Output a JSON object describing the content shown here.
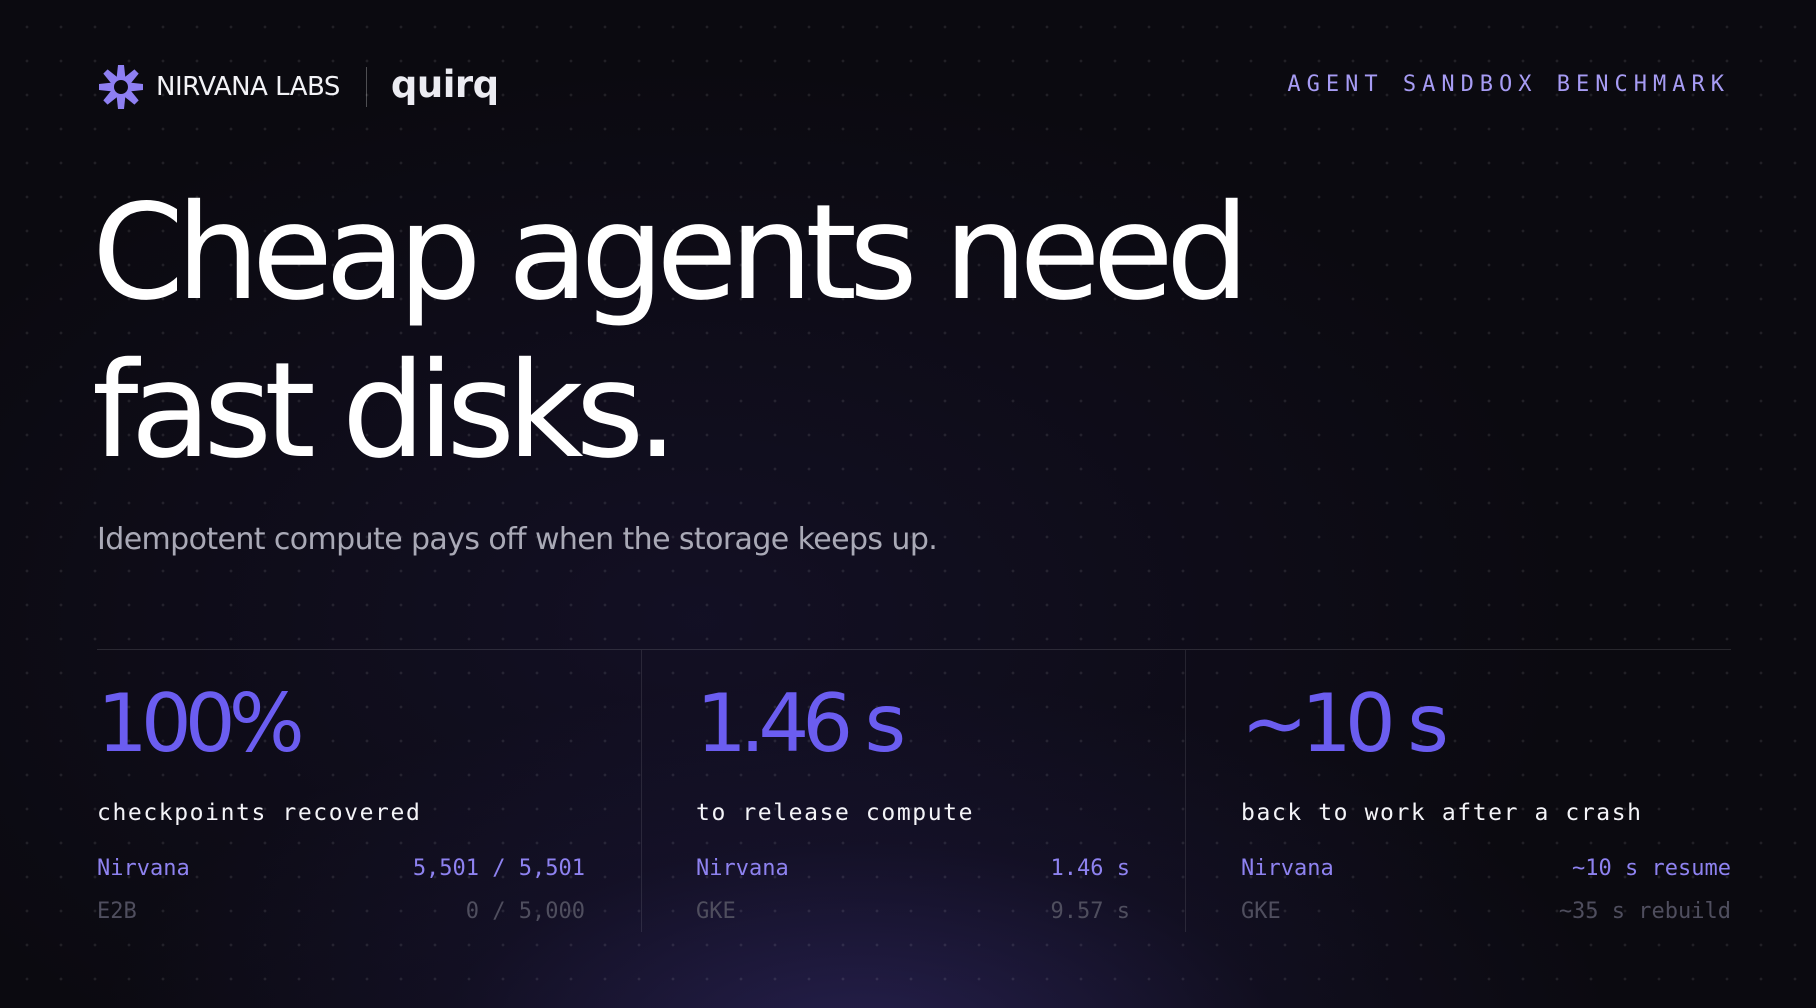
{
  "header": {
    "brand": "NIRVANA LABS",
    "partner": "quirq",
    "eyebrow": "AGENT SANDBOX BENCHMARK"
  },
  "hero": {
    "headline_line1": "Cheap agents need",
    "headline_line2": "fast disks.",
    "subhead": "Idempotent compute pays off when the storage keeps up."
  },
  "stats": [
    {
      "value": "100%",
      "label": "checkpoints recovered",
      "rows": [
        {
          "name": "Nirvana",
          "value": "5,501 / 5,501"
        },
        {
          "name": "E2B",
          "value": "0 / 5,000"
        }
      ]
    },
    {
      "value": "1.46 s",
      "label": "to release compute",
      "rows": [
        {
          "name": "Nirvana",
          "value": "1.46 s"
        },
        {
          "name": "GKE",
          "value": "9.57 s"
        }
      ]
    },
    {
      "value": "~10 s",
      "label": "back to work after a crash",
      "rows": [
        {
          "name": "Nirvana",
          "value": "~10 s resume"
        },
        {
          "name": "GKE",
          "value": "~35 s rebuild"
        }
      ]
    }
  ],
  "colors": {
    "background": "#0b0a10",
    "accent": "#6b5df0",
    "accent_light": "#a79cf4",
    "muted": "#4f4e5e"
  },
  "icons": {
    "brand_logo": "nirvana-starburst-logo"
  }
}
